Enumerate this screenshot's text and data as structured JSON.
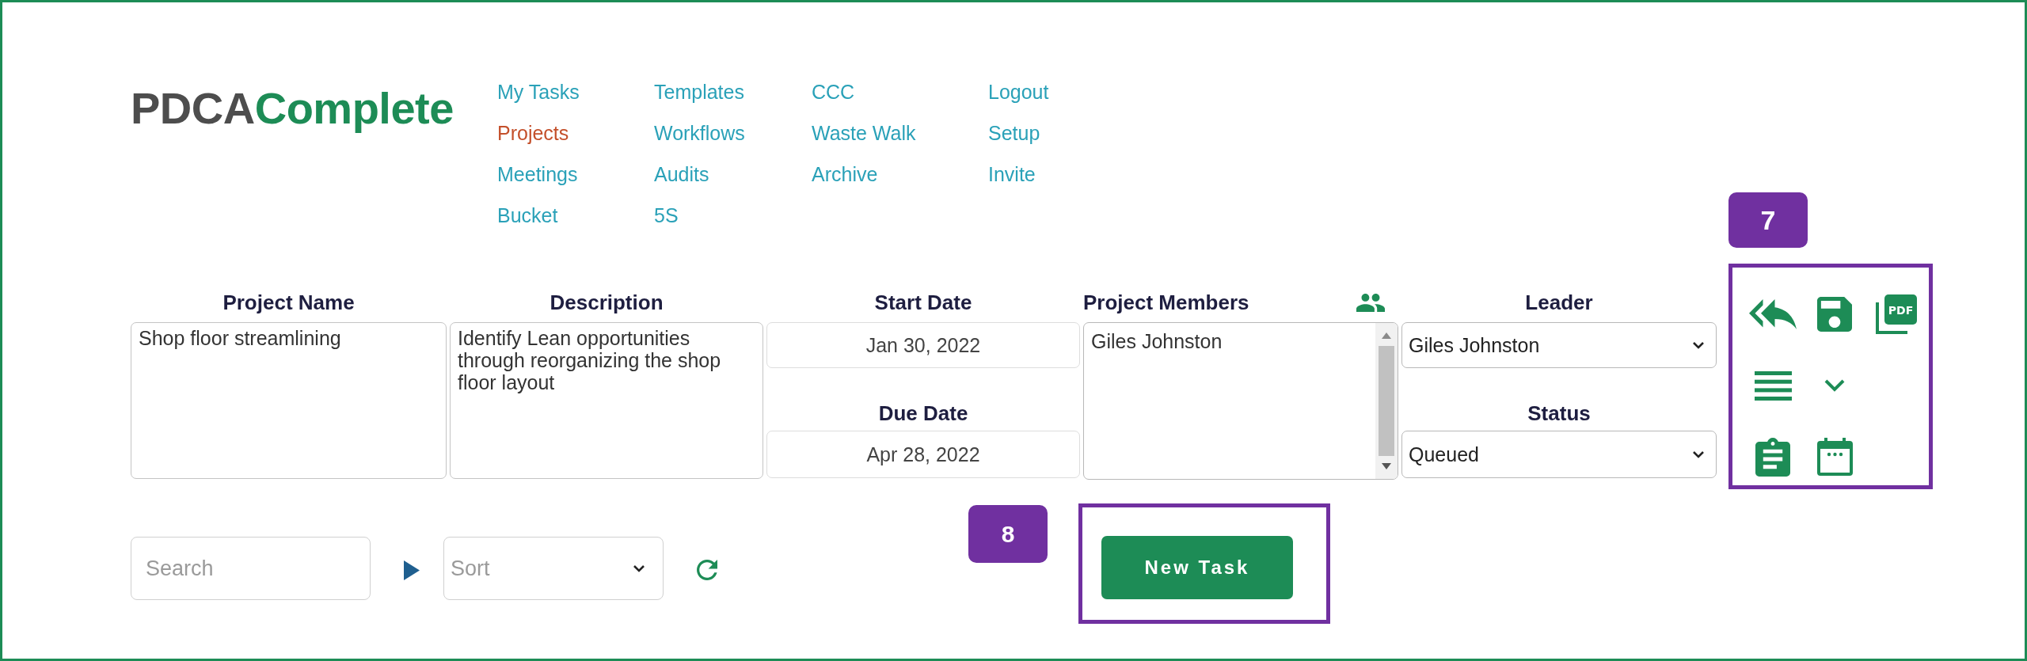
{
  "logo": {
    "prefix": "PDCA",
    "suffix": "Complete"
  },
  "nav": {
    "columns": [
      {
        "links": [
          {
            "label": "My Tasks",
            "selected": false
          },
          {
            "label": "Projects",
            "selected": true
          },
          {
            "label": "Meetings",
            "selected": false
          },
          {
            "label": "Bucket",
            "selected": false
          }
        ]
      },
      {
        "links": [
          {
            "label": "Templates",
            "selected": false
          },
          {
            "label": "Workflows",
            "selected": false
          },
          {
            "label": "Audits",
            "selected": false
          },
          {
            "label": "5S",
            "selected": false
          }
        ]
      },
      {
        "links": [
          {
            "label": "CCC",
            "selected": false
          },
          {
            "label": "Waste Walk",
            "selected": false
          },
          {
            "label": "Archive",
            "selected": false
          }
        ]
      },
      {
        "links": [
          {
            "label": "Logout",
            "selected": false
          },
          {
            "label": "Setup",
            "selected": false
          },
          {
            "label": "Invite",
            "selected": false
          }
        ]
      }
    ]
  },
  "form": {
    "project_name": {
      "label": "Project Name",
      "value": "Shop floor streamlining"
    },
    "description": {
      "label": "Description",
      "value": "Identify Lean opportunities through reorganizing the shop floor layout"
    },
    "start_date": {
      "label": "Start Date",
      "value": "Jan 30, 2022"
    },
    "due_date": {
      "label": "Due Date",
      "value": "Apr 28, 2022"
    },
    "project_members": {
      "label": "Project Members",
      "members": [
        "Giles Johnston"
      ]
    },
    "leader": {
      "label": "Leader",
      "value": "Giles Johnston"
    },
    "status": {
      "label": "Status",
      "value": "Queued"
    }
  },
  "icon_panel": {
    "callout": "7",
    "pdf_text": "PDF"
  },
  "task_bar": {
    "search": {
      "placeholder": "Search"
    },
    "sort": {
      "placeholder": "Sort"
    },
    "callout": "8",
    "new_task": {
      "label": "New Task"
    }
  }
}
